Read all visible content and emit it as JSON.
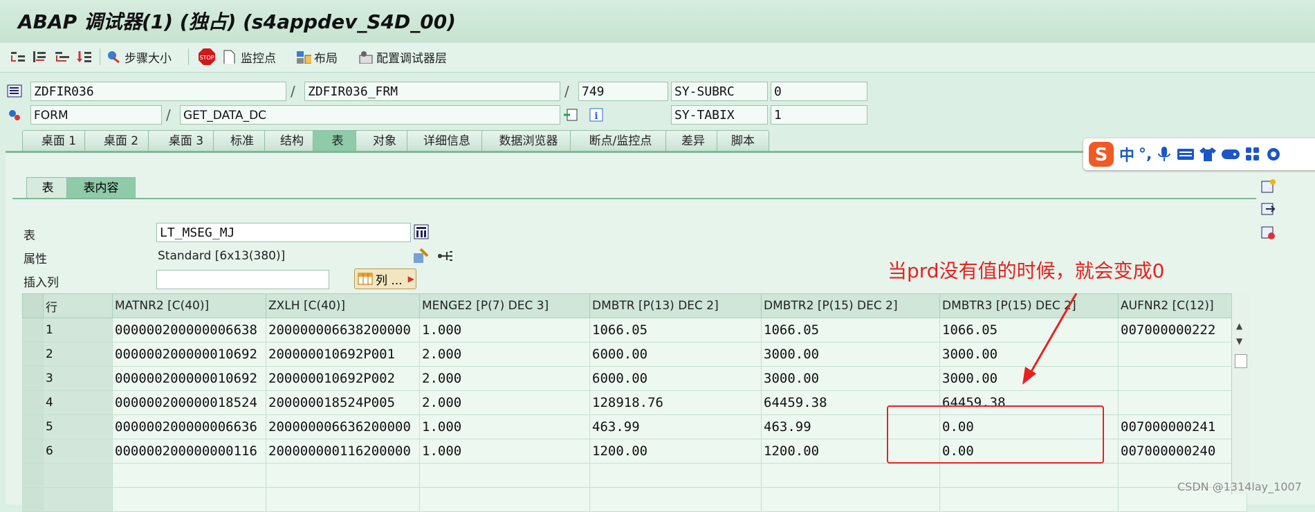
{
  "title": "ABAP 调试器(1)  (独占) (s4appdev_S4D_00)",
  "toolbar": {
    "step_size": "步骤大小",
    "watchpoint": "监控点",
    "layout": "布局",
    "config": "配置调试器层"
  },
  "header": {
    "program": "ZDFIR036",
    "include": "ZDFIR036_FRM",
    "line": "749",
    "f1_name": "SY-SUBRC",
    "f1_value": "0",
    "type": "FORM",
    "event": "GET_DATA_DC",
    "f2_name": "SY-TABIX",
    "f2_value": "1"
  },
  "tabs": [
    "桌面 1",
    "桌面 2",
    "桌面 3",
    "标准",
    "结构",
    "表",
    "对象",
    "详细信息",
    "数据浏览器",
    "断点/监控点",
    "差异",
    "脚本"
  ],
  "subtabs": [
    "表",
    "表内容"
  ],
  "form": {
    "table_label": "表",
    "table_value": "LT_MSEG_MJ",
    "attr_label": "属性",
    "attr_value": "Standard [6x13(380)]",
    "insert_label": "插入列",
    "columns_button": "列 ..."
  },
  "grid": {
    "headers": [
      "行",
      "MATNR2 [C(40)]",
      "ZXLH [C(40)]",
      "MENGE2 [P(7) DEC 3]",
      "DMBTR [P(13) DEC 2]",
      "DMBTR2 [P(15) DEC 2]",
      "DMBTR3 [P(15) DEC 2]",
      "AUFNR2 [C(12)]"
    ],
    "rows": [
      [
        "1",
        "000000200000006638",
        "200000006638200000",
        "1.000",
        "1066.05",
        "1066.05",
        "1066.05",
        "007000000222"
      ],
      [
        "2",
        "000000200000010692",
        "200000010692P001",
        "2.000",
        "6000.00",
        "3000.00",
        "3000.00",
        ""
      ],
      [
        "3",
        "000000200000010692",
        "200000010692P002",
        "2.000",
        "6000.00",
        "3000.00",
        "3000.00",
        ""
      ],
      [
        "4",
        "000000200000018524",
        "200000018524P005",
        "2.000",
        "128918.76",
        "64459.38",
        "64459.38",
        ""
      ],
      [
        "5",
        "000000200000006636",
        "200000006636200000",
        "1.000",
        "463.99",
        "463.99",
        "0.00",
        "007000000241"
      ],
      [
        "6",
        "000000200000000116",
        "200000000116200000",
        "1.000",
        "1200.00",
        "1200.00",
        "0.00",
        "007000000240"
      ],
      [
        "",
        "",
        "",
        "",
        "",
        "",
        "",
        ""
      ],
      [
        "",
        "",
        "",
        "",
        "",
        "",
        "",
        ""
      ]
    ]
  },
  "annotation": "当prd没有值的时候，就会变成0",
  "watermark": "CSDN @1314lay_1007",
  "ime": {
    "char": "中",
    "accent": "#e8211f"
  },
  "colors": {
    "accent_red": "#e8211f",
    "tab_active": "#8fcaa9"
  }
}
